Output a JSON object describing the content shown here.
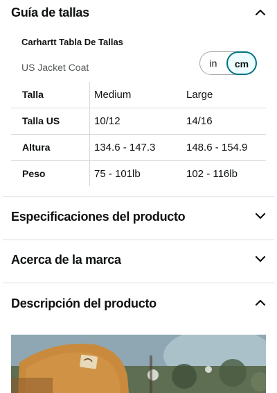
{
  "size_guide": {
    "title": "Guía de tallas",
    "brand_chart_title": "Carhartt Tabla De Tallas",
    "chart_subtitle": "US Jacket Coat",
    "unit_toggle": {
      "options": [
        "in",
        "cm"
      ],
      "selected": "cm"
    },
    "table": {
      "header": {
        "label": "Talla",
        "col_a": "Medium",
        "col_b": "Large"
      },
      "rows": [
        {
          "label": "Talla US",
          "col_a": "10/12",
          "col_b": "14/16"
        },
        {
          "label": "Altura",
          "col_a": "134.6 - 147.3",
          "col_b": "148.6 - 154.9"
        },
        {
          "label": "Peso",
          "col_a": "75 - 101lb",
          "col_b": "102 - 116lb"
        }
      ]
    }
  },
  "sections": [
    {
      "title": "Especificaciones del producto",
      "state": "collapsed",
      "icon": "chevron-down-icon"
    },
    {
      "title": "Acerca de la marca",
      "state": "collapsed",
      "icon": "chevron-down-icon"
    },
    {
      "title": "Descripción del producto",
      "state": "expanded",
      "icon": "chevron-up-icon"
    }
  ],
  "colors": {
    "text": "#0f1111",
    "muted": "#565959",
    "divider": "#d5d9d9",
    "toggle_active_border": "#007185",
    "toggle_active_bg": "#edfdff"
  }
}
